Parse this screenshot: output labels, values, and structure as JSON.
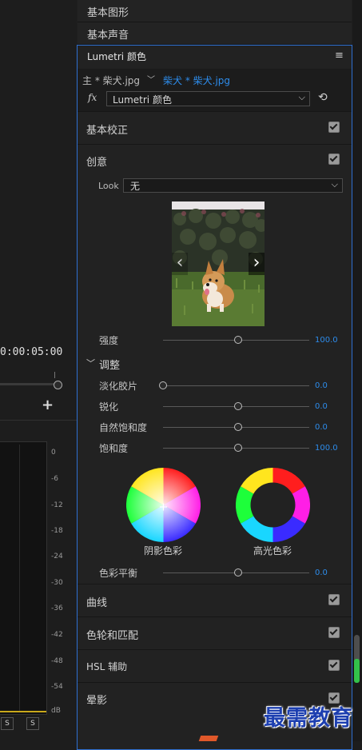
{
  "timeline": {
    "timecode": "0:00:05:00",
    "add_label": "+"
  },
  "audio_meter": {
    "db_ticks": [
      "0",
      "-6",
      "-12",
      "-18",
      "-24",
      "-30",
      "-36",
      "-42",
      "-48",
      "-54",
      "dB"
    ],
    "solo_buttons": [
      "S",
      "S"
    ]
  },
  "tabs": {
    "basic_graphics": "基本图形",
    "basic_sound": "基本声音"
  },
  "lumetri": {
    "title": "Lumetri 颜色",
    "menu_icon": "hamburger-icon",
    "clip_master": "主 * 柴犬.jpg",
    "clip_active": "柴犬 * 柴犬.jpg",
    "fx_label": "fx",
    "effect_name": "Lumetri 颜色",
    "sections": {
      "basic_correction": "基本校正",
      "creative": "创意",
      "curves": "曲线",
      "color_wheels": "色轮和匹配",
      "hsl": "HSL 辅助",
      "vignette": "晕影"
    },
    "look": {
      "label": "Look",
      "value": "无"
    },
    "creative": {
      "intensity": {
        "label": "强度",
        "value": "100.0",
        "level": 0.5
      },
      "adjust_title": "调整",
      "faded_film": {
        "label": "淡化胶片",
        "value": "0.0",
        "level": 0.0
      },
      "sharpen": {
        "label": "锐化",
        "value": "0.0",
        "level": 0.5
      },
      "vibrance": {
        "label": "自然饱和度",
        "value": "0.0",
        "level": 0.5
      },
      "saturation": {
        "label": "饱和度",
        "value": "100.0",
        "level": 0.5
      },
      "shadow_tint": "阴影色彩",
      "highlight_tint": "高光色彩",
      "tint_balance": {
        "label": "色彩平衡",
        "value": "0.0",
        "level": 0.5
      }
    }
  },
  "watermark": "最需教育",
  "colors": {
    "accent_blue": "#2d8ceb",
    "panel_border": "#2e6fd0",
    "scroll_green": "#33c24a"
  }
}
